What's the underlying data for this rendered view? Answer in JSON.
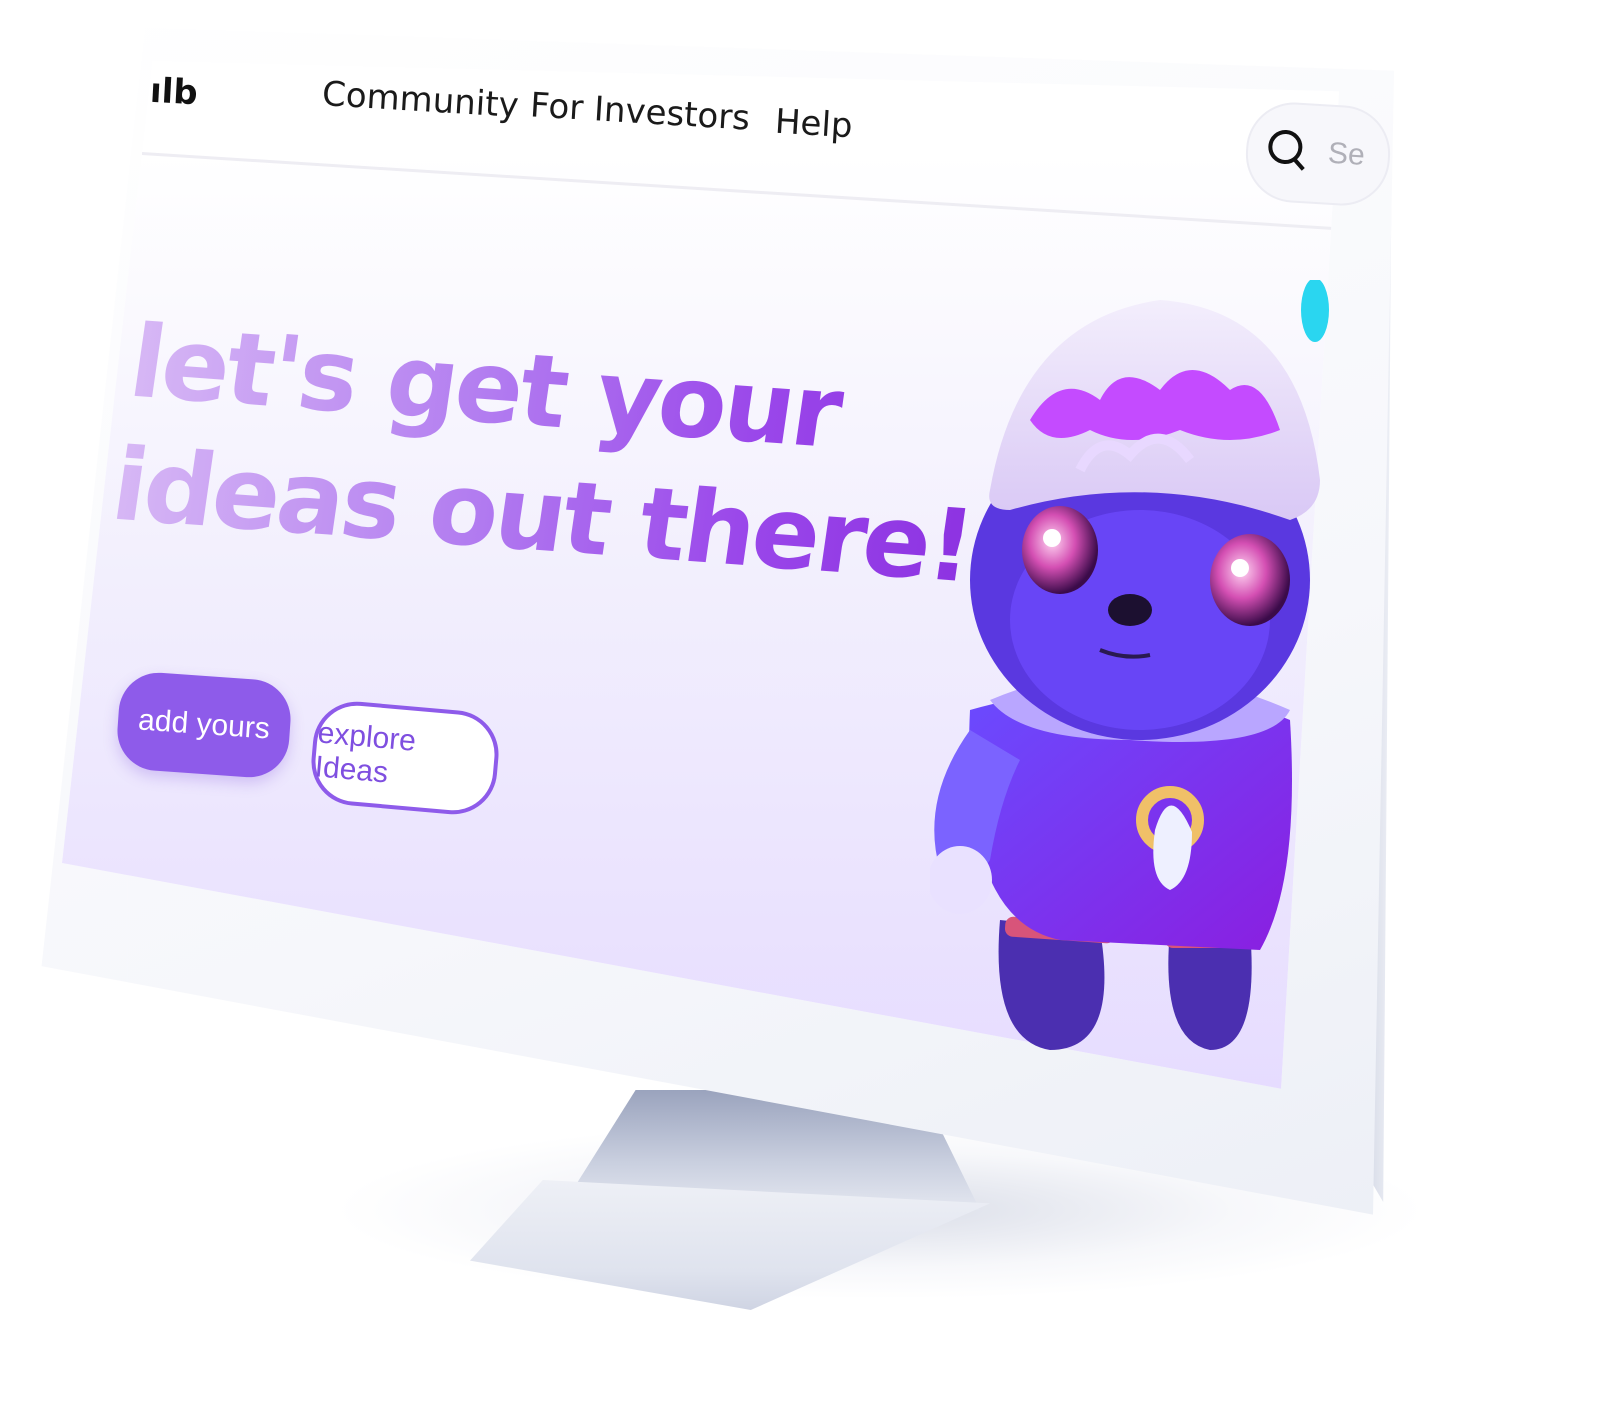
{
  "nav": {
    "logo": "ılb",
    "links": [
      "Community",
      "For Investors",
      "Help"
    ],
    "search_placeholder": "Se"
  },
  "hero": {
    "headline": "let's get your ideas out there!",
    "primary_button": "add yours",
    "secondary_button": "explore Ideas",
    "mascot": "purple-bear-mascot"
  },
  "colors": {
    "accent": "#8e5bea",
    "headline_start": "#d7b8f5",
    "headline_end": "#8b2fe0",
    "hero_bg": "#e6dcff"
  }
}
